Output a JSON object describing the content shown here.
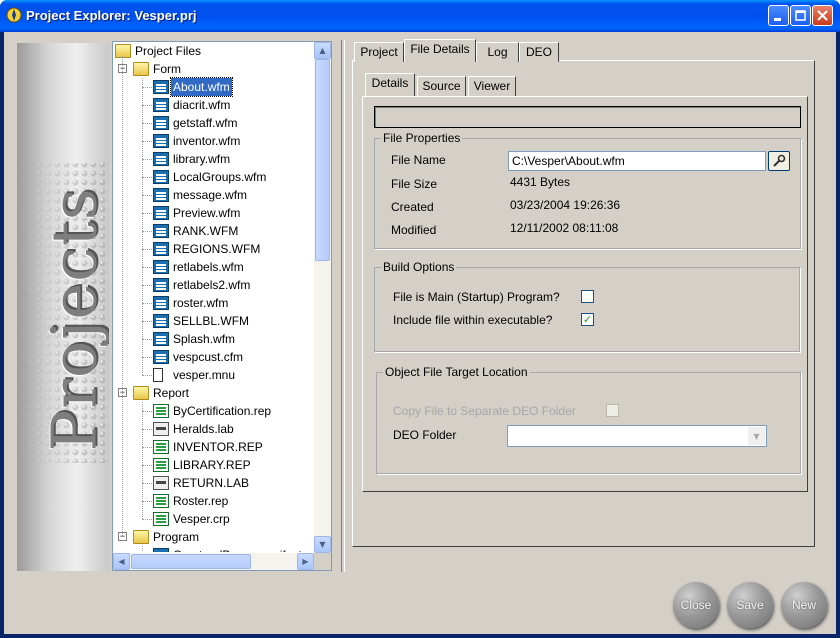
{
  "window": {
    "title": "Project Explorer: Vesper.prj"
  },
  "banner": {
    "text": "Projects"
  },
  "tree": {
    "root": "Project Files",
    "groups": [
      {
        "name": "Form",
        "items": [
          "About.wfm",
          "diacrit.wfm",
          "getstaff.wfm",
          "inventor.wfm",
          "library.wfm",
          "LocalGroups.wfm",
          "message.wfm",
          "Preview.wfm",
          "RANK.WFM",
          "REGIONS.WFM",
          "retlabels.wfm",
          "retlabels2.wfm",
          "roster.wfm",
          "SELLBL.WFM",
          "Splash.wfm",
          "vespcust.cfm",
          "vesper.mnu"
        ]
      },
      {
        "name": "Report",
        "items": [
          "ByCertification.rep",
          "Heralds.lab",
          "INVENTOR.REP",
          "LIBRARY.REP",
          "RETURN.LAB",
          "Roster.rep",
          "Vesper.crp"
        ]
      },
      {
        "name": "Program",
        "items": [
          "Create_dBase_manifest..."
        ]
      }
    ],
    "selected": "About.wfm"
  },
  "tabs": [
    "Project",
    "File Details",
    "Log",
    "DEO"
  ],
  "active_tab": "File Details",
  "subtabs": [
    "Details",
    "Source",
    "Viewer"
  ],
  "active_subtab": "Details",
  "file_properties": {
    "legend": "File Properties",
    "file_name_label": "File Name",
    "file_name_value": "C:\\Vesper\\About.wfm",
    "file_size_label": "File Size",
    "file_size_value": "4431 Bytes",
    "created_label": "Created",
    "created_value": "03/23/2004 19:26:36",
    "modified_label": "Modified",
    "modified_value": "12/11/2002 08:11:08"
  },
  "build_options": {
    "legend": "Build Options",
    "main_label": "File is Main (Startup) Program?",
    "main_checked": false,
    "include_label": "Include file within executable?",
    "include_checked": true
  },
  "object_target": {
    "legend": "Object File Target Location",
    "copy_label": "Copy File to Separate DEO Folder",
    "copy_checked": false,
    "deo_label": "DEO Folder",
    "deo_value": ""
  },
  "buttons": {
    "close": "Close",
    "save": "Save",
    "new": "New"
  },
  "colors": {
    "titlebar": "#0053ee",
    "selection": "#316ac5",
    "face": "#d4d0c8"
  }
}
